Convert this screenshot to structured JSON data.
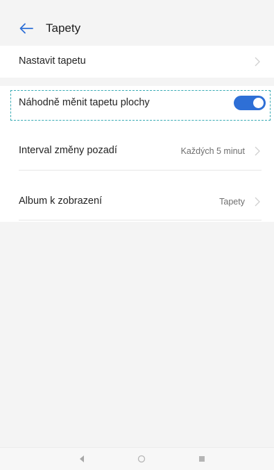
{
  "header": {
    "title": "Tapety",
    "back_icon": "arrow-left-icon"
  },
  "settings": {
    "set_wallpaper": {
      "label": "Nastavit tapetu"
    },
    "random_change": {
      "label": "Náhodně měnit tapetu plochy",
      "toggle_on": true
    },
    "interval": {
      "label": "Interval změny pozadí",
      "value": "Každých 5 minut"
    },
    "album": {
      "label": "Album k zobrazení",
      "value": "Tapety"
    }
  },
  "colors": {
    "accent": "#2e6fd6",
    "highlight": "#35a9b3",
    "background": "#f4f4f4"
  },
  "navbar": {
    "icons": [
      "back-triangle-icon",
      "home-circle-icon",
      "recent-square-icon"
    ]
  }
}
